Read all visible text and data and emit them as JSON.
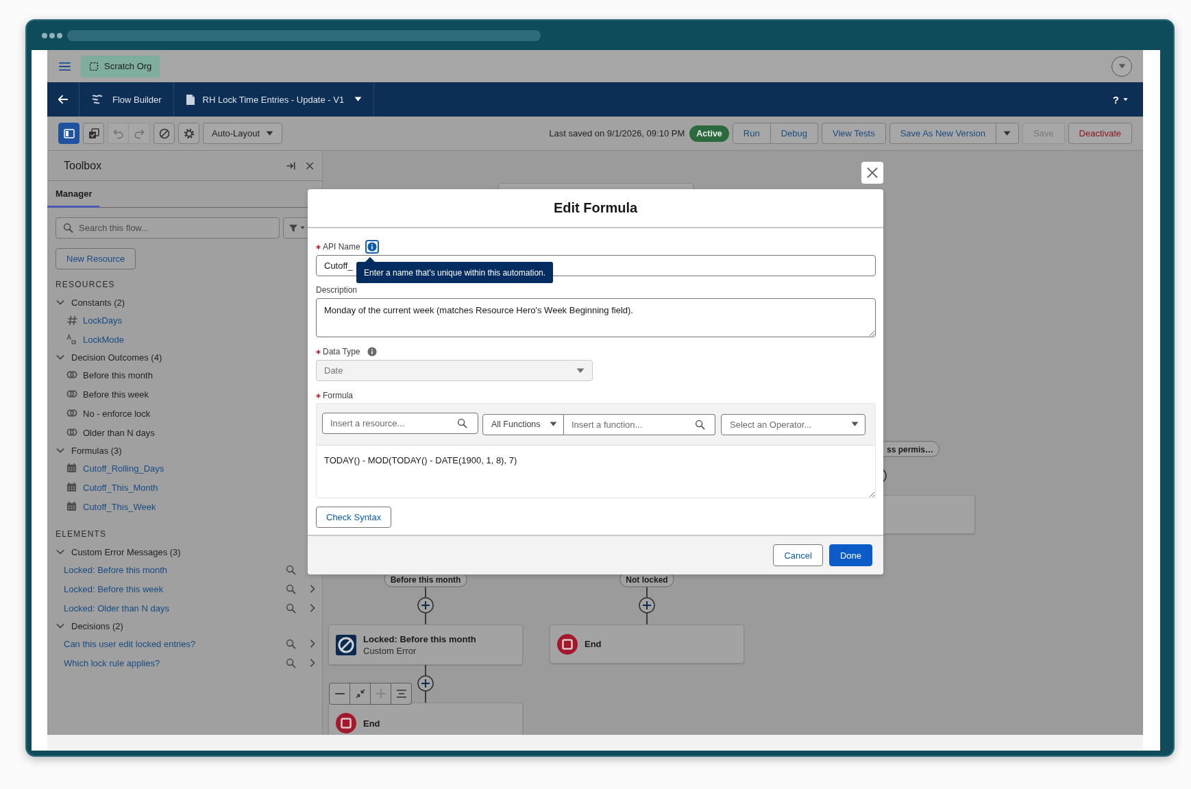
{
  "top_bar": {
    "org_name": "Scratch Org"
  },
  "nav_bar": {
    "app_name": "Flow Builder",
    "flow_title": "RH Lock Time Entries - Update - V1",
    "help": "?"
  },
  "toolbar": {
    "icon_buttons": [
      {
        "kind": "panel",
        "selected": true,
        "disabled": false
      },
      {
        "kind": "copy",
        "selected": false,
        "disabled": false
      },
      {
        "kind": "undo",
        "selected": false,
        "disabled": true
      },
      {
        "kind": "redo",
        "selected": false,
        "disabled": true
      },
      {
        "kind": "errors",
        "selected": false,
        "disabled": false
      },
      {
        "kind": "settings",
        "selected": false,
        "disabled": false
      }
    ],
    "layout_mode": "Auto-Layout",
    "last_saved": "Last saved on 9/1/2026, 09:10 PM",
    "status": "Active",
    "buttons": [
      {
        "label": "Run",
        "kind": "segment",
        "disabled": false
      },
      {
        "label": "Debug",
        "kind": "segment",
        "disabled": false
      },
      {
        "label": "View Tests",
        "kind": "neutral",
        "disabled": false
      },
      {
        "label": "Save As New Version",
        "kind": "split",
        "disabled": false
      },
      {
        "label": "Save",
        "kind": "neutral",
        "disabled": true
      },
      {
        "label": "Deactivate",
        "kind": "destructive",
        "disabled": false
      }
    ]
  },
  "toolbox": {
    "title": "Toolbox",
    "tabs": [
      {
        "label": "Manager",
        "selected": true
      }
    ],
    "search": {
      "placeholder": "Search this flow..."
    },
    "new_button": "New Resource",
    "sections": [
      {
        "heading": "RESOURCES",
        "groups": [
          {
            "label": "Constants (2)",
            "expanded": true,
            "items": [
              {
                "label": "LockDays",
                "kind": "number"
              },
              {
                "label": "LockMode",
                "kind": "text"
              }
            ]
          },
          {
            "label": "Decision Outcomes (4)",
            "expanded": true,
            "items": [
              {
                "label": "Before this month",
                "kind": "outcome"
              },
              {
                "label": "Before this week",
                "kind": "outcome"
              },
              {
                "label": "No - enforce lock",
                "kind": "outcome"
              },
              {
                "label": "Older than N days",
                "kind": "outcome"
              }
            ]
          },
          {
            "label": "Formulas (3)",
            "expanded": true,
            "items": [
              {
                "label": "Cutoff_Rolling_Days",
                "kind": "formula"
              },
              {
                "label": "Cutoff_This_Month",
                "kind": "formula"
              },
              {
                "label": "Cutoff_This_Week",
                "kind": "formula"
              }
            ]
          }
        ]
      },
      {
        "heading": "ELEMENTS",
        "groups": [
          {
            "label": "Custom Error Messages (3)",
            "expanded": true,
            "items": [
              {
                "label": "Locked: Before this month",
                "kind": "element"
              },
              {
                "label": "Locked: Before this week",
                "kind": "element"
              },
              {
                "label": "Locked: Older than N days",
                "kind": "element"
              }
            ]
          },
          {
            "label": "Decisions (2)",
            "expanded": true,
            "items": [
              {
                "label": "Can this user edit locked entries?",
                "kind": "element"
              },
              {
                "label": "Which lock rule applies?",
                "kind": "element"
              }
            ]
          }
        ]
      }
    ]
  },
  "canvas": {
    "connector_labels": [
      {
        "label": "ss permis…"
      },
      {
        "label": "Before this month"
      },
      {
        "label": "Not locked"
      }
    ],
    "nodes": [
      {
        "kind": "blank"
      },
      {
        "kind": "blank"
      },
      {
        "kind": "custom_error",
        "title": "Locked: Before this month",
        "subtitle": "Custom Error"
      },
      {
        "kind": "end",
        "title": "End"
      },
      {
        "kind": "end",
        "title": "End"
      }
    ],
    "zoom_controls": [
      {
        "kind": "zoom_out",
        "disabled": false
      },
      {
        "kind": "fit",
        "disabled": false
      },
      {
        "kind": "zoom_in",
        "disabled": true
      },
      {
        "kind": "align",
        "disabled": false
      }
    ]
  },
  "modal": {
    "title": "Edit Formula",
    "api_name": {
      "label": "API Name",
      "required": true,
      "value": "Cutoff_",
      "tooltip": "Enter a name that's unique within this automation."
    },
    "description": {
      "label": "Description",
      "value": "Monday of the current week (matches Resource Hero's Week Beginning field)."
    },
    "data_type": {
      "label": "Data Type",
      "required": true,
      "value": "Date",
      "disabled": true
    },
    "formula": {
      "label": "Formula",
      "required": true,
      "resource_search": {
        "placeholder": "Insert a resource..."
      },
      "function_category": {
        "value": "All Functions"
      },
      "function_search": {
        "placeholder": "Insert a function..."
      },
      "operator": {
        "placeholder": "Select an Operator..."
      },
      "value": "TODAY() - MOD(TODAY() - DATE(1900, 1, 8), 7)"
    },
    "check_button": "Check Syntax",
    "footer_buttons": [
      {
        "label": "Cancel",
        "kind": "neutral"
      },
      {
        "label": "Done",
        "kind": "brand"
      }
    ]
  }
}
